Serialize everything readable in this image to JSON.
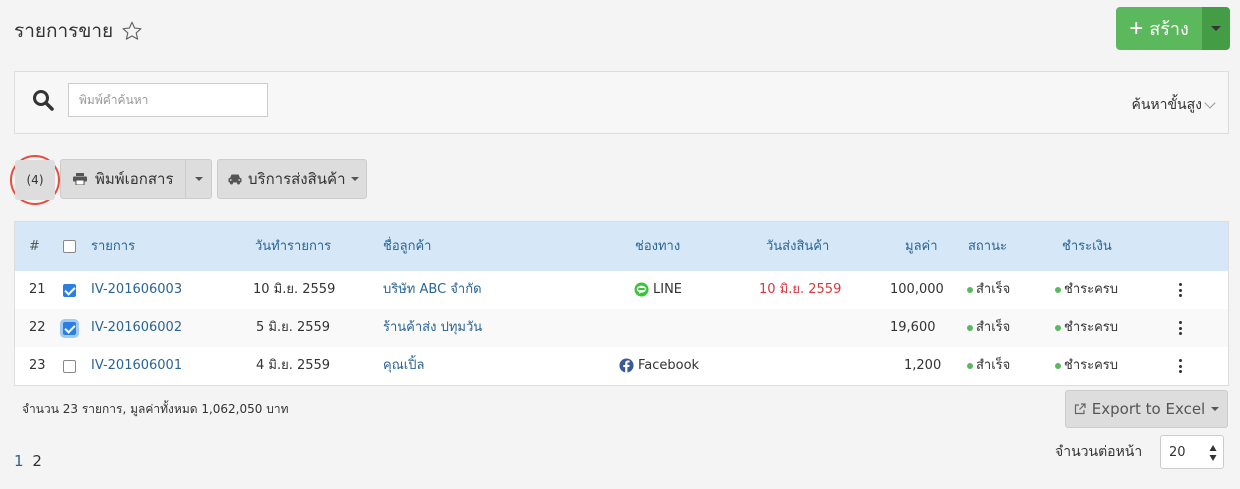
{
  "header": {
    "title": "รายการขาย",
    "create_label": "สร้าง"
  },
  "search": {
    "placeholder": "พิมพ์คำค้นหา",
    "advanced_label": "ค้นหาขั้นสูง"
  },
  "toolbar": {
    "selected_count": "(4)",
    "print_label": "พิมพ์เอกสาร",
    "shipping_label": "บริการส่งสินค้า"
  },
  "table": {
    "columns": [
      "#",
      "รายการ",
      "วันทำรายการ",
      "ชื่อลูกค้า",
      "ช่องทาง",
      "วันส่งสินค้า",
      "มูลค่า",
      "สถานะ",
      "ชำระเงิน"
    ],
    "rows": [
      {
        "num": "21",
        "checked": true,
        "doc": "IV-201606003",
        "date": "10 มิ.ย. 2559",
        "customer": "บริษัท ABC จำกัด",
        "channel": "LINE",
        "channel_icon": "line-icon",
        "ship_date": "10 มิ.ย. 2559",
        "amount": "100,000",
        "status": "สำเร็จ",
        "payment": "ชำระครบ"
      },
      {
        "num": "22",
        "checked": true,
        "doc": "IV-201606002",
        "date": "5 มิ.ย. 2559",
        "customer": "ร้านค้าส่ง ปทุมวัน",
        "channel": "",
        "channel_icon": "",
        "ship_date": "",
        "amount": "19,600",
        "status": "สำเร็จ",
        "payment": "ชำระครบ"
      },
      {
        "num": "23",
        "checked": false,
        "doc": "IV-201606001",
        "date": "4 มิ.ย. 2559",
        "customer": "คุณเปิ้ล",
        "channel": "Facebook",
        "channel_icon": "facebook-icon",
        "ship_date": "",
        "amount": "1,200",
        "status": "สำเร็จ",
        "payment": "ชำระครบ"
      }
    ]
  },
  "footer": {
    "summary": "จำนวน 23 รายการ, มูลค่าทั้งหมด 1,062,050 บาท",
    "export_label": "Export to Excel",
    "pages": [
      "1",
      "2"
    ],
    "per_page_label": "จำนวนต่อหน้า",
    "per_page_value": "20"
  },
  "colors": {
    "primary_green": "#5cb85c",
    "header_blue": "#d6e8f7",
    "link_blue": "#2a6496",
    "ship_red": "#d9363e",
    "highlight_circle": "#e74c3c"
  }
}
